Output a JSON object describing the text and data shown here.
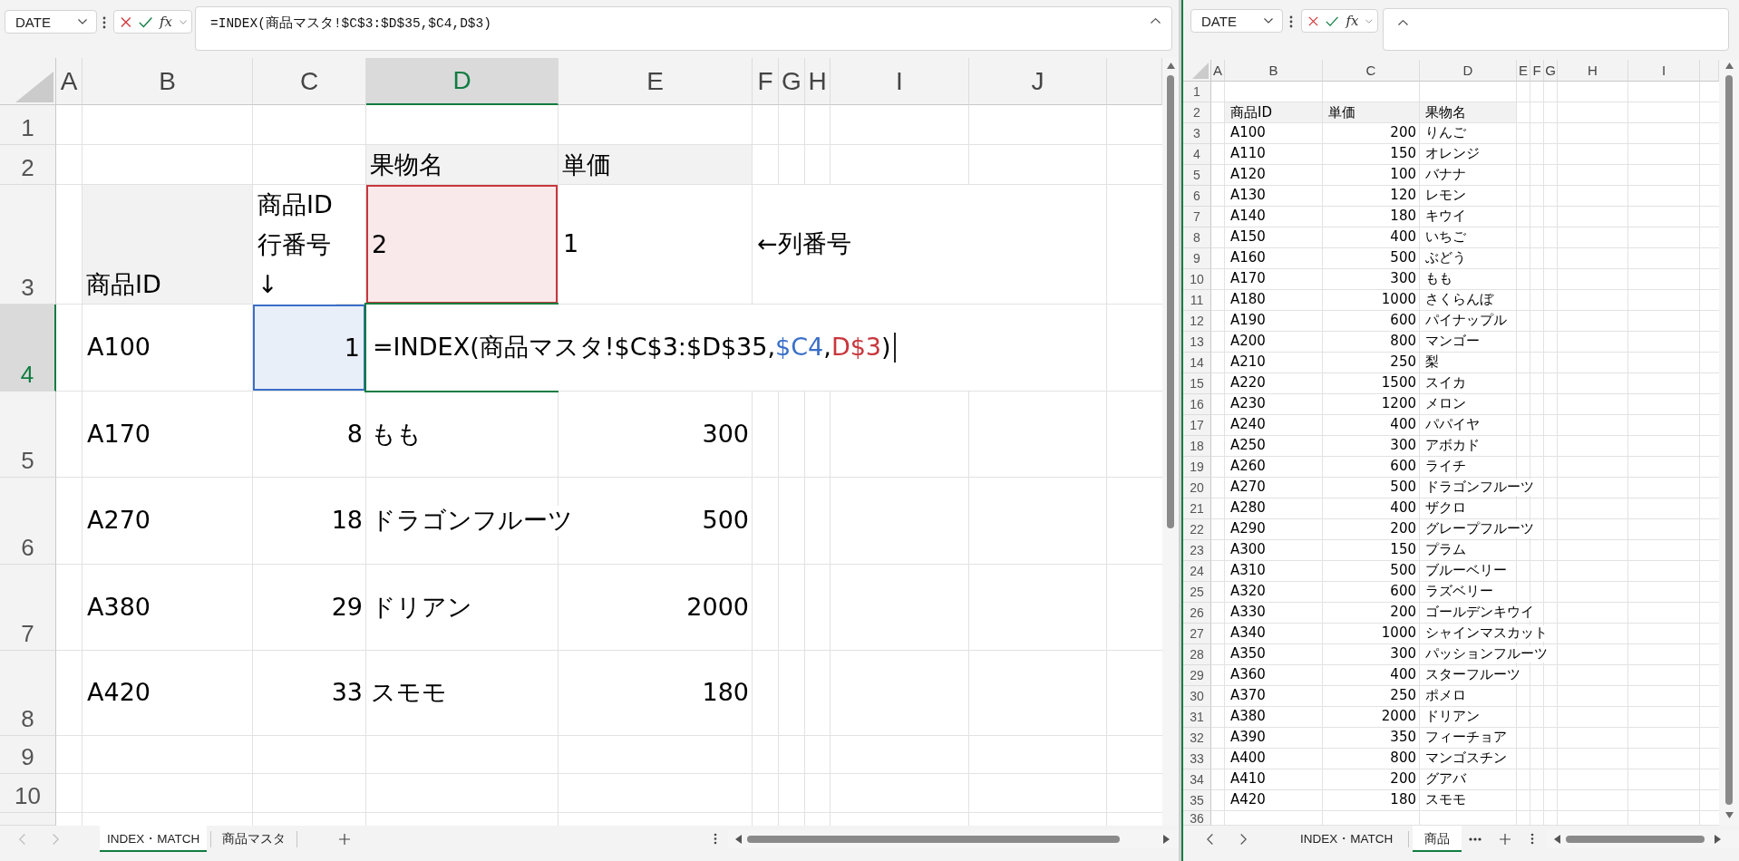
{
  "left_window": {
    "name_box": "DATE",
    "insert_function": "fx",
    "formula_bar": "=INDEX(商品マスタ!$C$3:$D$35,$C4,D$3)",
    "columns": [
      {
        "label": "A",
        "selected": false
      },
      {
        "label": "B",
        "selected": false
      },
      {
        "label": "C",
        "selected": false
      },
      {
        "label": "D",
        "selected": true
      },
      {
        "label": "E",
        "selected": false
      },
      {
        "label": "F",
        "selected": false
      },
      {
        "label": "G",
        "selected": false
      },
      {
        "label": "H",
        "selected": false
      },
      {
        "label": "I",
        "selected": false
      },
      {
        "label": "J",
        "selected": false
      }
    ],
    "rows": [
      {
        "label": "1",
        "selected": false
      },
      {
        "label": "2",
        "selected": false,
        "cells": [
          {
            "kind": "blank"
          },
          {
            "kind": "blank"
          },
          {
            "kind": "header",
            "text": "果物名"
          },
          {
            "kind": "header",
            "text": "単価"
          }
        ]
      },
      {
        "label": "3",
        "selected": false,
        "cells": [
          {
            "kind": "header",
            "text": "商品ID"
          },
          {
            "kind": "lines",
            "lines": [
              "商品ID",
              "行番号",
              "↓"
            ]
          },
          {
            "kind": "text",
            "text": "2",
            "color": "#c8363d"
          },
          {
            "kind": "text",
            "text": "1"
          },
          {
            "kind": "text",
            "text": "←列番号"
          }
        ]
      },
      {
        "label": "4",
        "selected": true,
        "cells": [
          {
            "kind": "text",
            "text": "A100"
          },
          {
            "kind": "number",
            "text": "1",
            "color": "#3a6fc8"
          },
          {
            "kind": "formula",
            "start": "=INDEX(商品マスタ!$C$3:$D$35,",
            "row_reference": {
              "text": "$C4",
              "color": "#3a6fc8"
            },
            "separator": ",",
            "column_reference": {
              "text": "D$3",
              "color": "#c8363d"
            },
            "end": ")"
          }
        ]
      },
      {
        "label": "5",
        "selected": false,
        "cells": [
          {
            "kind": "text",
            "text": "A170"
          },
          {
            "kind": "number",
            "text": "8"
          },
          {
            "kind": "text",
            "text": "もも"
          },
          {
            "kind": "number",
            "text": "300"
          }
        ]
      },
      {
        "label": "6",
        "selected": false,
        "cells": [
          {
            "kind": "text",
            "text": "A270"
          },
          {
            "kind": "number",
            "text": "18"
          },
          {
            "kind": "text",
            "text": "ドラゴンフルーツ"
          },
          {
            "kind": "number",
            "text": "500"
          }
        ]
      },
      {
        "label": "7",
        "selected": false,
        "cells": [
          {
            "kind": "text",
            "text": "A380"
          },
          {
            "kind": "number",
            "text": "29"
          },
          {
            "kind": "text",
            "text": "ドリアン"
          },
          {
            "kind": "number",
            "text": "2000"
          }
        ]
      },
      {
        "label": "8",
        "selected": false,
        "cells": [
          {
            "kind": "text",
            "text": "A420"
          },
          {
            "kind": "number",
            "text": "33"
          },
          {
            "kind": "text",
            "text": "スモモ"
          },
          {
            "kind": "number",
            "text": "180"
          }
        ]
      },
      {
        "label": "9",
        "selected": false
      },
      {
        "label": "10",
        "selected": false
      }
    ],
    "sheet_nav": {
      "disabled": true
    },
    "sheet_tabs": [
      {
        "label": "INDEX・MATCH",
        "selected": true
      },
      {
        "label": "商品マスタ",
        "selected": false
      }
    ]
  },
  "right_window": {
    "name_box": "DATE",
    "insert_function": "fx",
    "columns": [
      {
        "label": "A",
        "selected": false
      },
      {
        "label": "B",
        "selected": false
      },
      {
        "label": "C",
        "selected": false
      },
      {
        "label": "D",
        "selected": false
      },
      {
        "label": "E",
        "selected": false
      },
      {
        "label": "F",
        "selected": false
      },
      {
        "label": "G",
        "selected": false
      },
      {
        "label": "H",
        "selected": false
      },
      {
        "label": "I",
        "selected": false
      }
    ],
    "rows": [
      {
        "label": "1",
        "selected": false
      },
      {
        "label": "2",
        "selected": false,
        "cells": [
          {
            "kind": "header",
            "text": "商品ID"
          },
          {
            "kind": "header",
            "text": "単価"
          },
          {
            "kind": "header",
            "text": "果物名"
          }
        ]
      },
      {
        "label": "3",
        "selected": false,
        "cells": [
          {
            "kind": "text",
            "text": "A100"
          },
          {
            "kind": "number",
            "text": "200"
          },
          {
            "kind": "text",
            "text": "りんご"
          }
        ]
      },
      {
        "label": "4",
        "selected": false,
        "cells": [
          {
            "kind": "text",
            "text": "A110"
          },
          {
            "kind": "number",
            "text": "150"
          },
          {
            "kind": "text",
            "text": "オレンジ"
          }
        ]
      },
      {
        "label": "5",
        "selected": false,
        "cells": [
          {
            "kind": "text",
            "text": "A120"
          },
          {
            "kind": "number",
            "text": "100"
          },
          {
            "kind": "text",
            "text": "バナナ"
          }
        ]
      },
      {
        "label": "6",
        "selected": false,
        "cells": [
          {
            "kind": "text",
            "text": "A130"
          },
          {
            "kind": "number",
            "text": "120"
          },
          {
            "kind": "text",
            "text": "レモン"
          }
        ]
      },
      {
        "label": "7",
        "selected": false,
        "cells": [
          {
            "kind": "text",
            "text": "A140"
          },
          {
            "kind": "number",
            "text": "180"
          },
          {
            "kind": "text",
            "text": "キウイ"
          }
        ]
      },
      {
        "label": "8",
        "selected": false,
        "cells": [
          {
            "kind": "text",
            "text": "A150"
          },
          {
            "kind": "number",
            "text": "400"
          },
          {
            "kind": "text",
            "text": "いちご"
          }
        ]
      },
      {
        "label": "9",
        "selected": false,
        "cells": [
          {
            "kind": "text",
            "text": "A160"
          },
          {
            "kind": "number",
            "text": "500"
          },
          {
            "kind": "text",
            "text": "ぶどう"
          }
        ]
      },
      {
        "label": "10",
        "selected": false,
        "cells": [
          {
            "kind": "text",
            "text": "A170"
          },
          {
            "kind": "number",
            "text": "300"
          },
          {
            "kind": "text",
            "text": "もも"
          }
        ]
      },
      {
        "label": "11",
        "selected": false,
        "cells": [
          {
            "kind": "text",
            "text": "A180"
          },
          {
            "kind": "number",
            "text": "1000"
          },
          {
            "kind": "text",
            "text": "さくらんぼ"
          }
        ]
      },
      {
        "label": "12",
        "selected": false,
        "cells": [
          {
            "kind": "text",
            "text": "A190"
          },
          {
            "kind": "number",
            "text": "600"
          },
          {
            "kind": "text",
            "text": "パイナップル"
          }
        ]
      },
      {
        "label": "13",
        "selected": false,
        "cells": [
          {
            "kind": "text",
            "text": "A200"
          },
          {
            "kind": "number",
            "text": "800"
          },
          {
            "kind": "text",
            "text": "マンゴー"
          }
        ]
      },
      {
        "label": "14",
        "selected": false,
        "cells": [
          {
            "kind": "text",
            "text": "A210"
          },
          {
            "kind": "number",
            "text": "250"
          },
          {
            "kind": "text",
            "text": "梨"
          }
        ]
      },
      {
        "label": "15",
        "selected": false,
        "cells": [
          {
            "kind": "text",
            "text": "A220"
          },
          {
            "kind": "number",
            "text": "1500"
          },
          {
            "kind": "text",
            "text": "スイカ"
          }
        ]
      },
      {
        "label": "16",
        "selected": false,
        "cells": [
          {
            "kind": "text",
            "text": "A230"
          },
          {
            "kind": "number",
            "text": "1200"
          },
          {
            "kind": "text",
            "text": "メロン"
          }
        ]
      },
      {
        "label": "17",
        "selected": false,
        "cells": [
          {
            "kind": "text",
            "text": "A240"
          },
          {
            "kind": "number",
            "text": "400"
          },
          {
            "kind": "text",
            "text": "パパイヤ"
          }
        ]
      },
      {
        "label": "18",
        "selected": false,
        "cells": [
          {
            "kind": "text",
            "text": "A250"
          },
          {
            "kind": "number",
            "text": "300"
          },
          {
            "kind": "text",
            "text": "アボカド"
          }
        ]
      },
      {
        "label": "19",
        "selected": false,
        "cells": [
          {
            "kind": "text",
            "text": "A260"
          },
          {
            "kind": "number",
            "text": "600"
          },
          {
            "kind": "text",
            "text": "ライチ"
          }
        ]
      },
      {
        "label": "20",
        "selected": false,
        "cells": [
          {
            "kind": "text",
            "text": "A270"
          },
          {
            "kind": "number",
            "text": "500"
          },
          {
            "kind": "text",
            "text": "ドラゴンフルーツ"
          }
        ]
      },
      {
        "label": "21",
        "selected": false,
        "cells": [
          {
            "kind": "text",
            "text": "A280"
          },
          {
            "kind": "number",
            "text": "400"
          },
          {
            "kind": "text",
            "text": "ザクロ"
          }
        ]
      },
      {
        "label": "22",
        "selected": false,
        "cells": [
          {
            "kind": "text",
            "text": "A290"
          },
          {
            "kind": "number",
            "text": "200"
          },
          {
            "kind": "text",
            "text": "グレープフルーツ"
          }
        ]
      },
      {
        "label": "23",
        "selected": false,
        "cells": [
          {
            "kind": "text",
            "text": "A300"
          },
          {
            "kind": "number",
            "text": "150"
          },
          {
            "kind": "text",
            "text": "プラム"
          }
        ]
      },
      {
        "label": "24",
        "selected": false,
        "cells": [
          {
            "kind": "text",
            "text": "A310"
          },
          {
            "kind": "number",
            "text": "500"
          },
          {
            "kind": "text",
            "text": "ブルーベリー"
          }
        ]
      },
      {
        "label": "25",
        "selected": false,
        "cells": [
          {
            "kind": "text",
            "text": "A320"
          },
          {
            "kind": "number",
            "text": "600"
          },
          {
            "kind": "text",
            "text": "ラズベリー"
          }
        ]
      },
      {
        "label": "26",
        "selected": false,
        "cells": [
          {
            "kind": "text",
            "text": "A330"
          },
          {
            "kind": "number",
            "text": "200"
          },
          {
            "kind": "text",
            "text": "ゴールデンキウイ"
          }
        ]
      },
      {
        "label": "27",
        "selected": false,
        "cells": [
          {
            "kind": "text",
            "text": "A340"
          },
          {
            "kind": "number",
            "text": "1000"
          },
          {
            "kind": "text",
            "text": "シャインマスカット"
          }
        ]
      },
      {
        "label": "28",
        "selected": false,
        "cells": [
          {
            "kind": "text",
            "text": "A350"
          },
          {
            "kind": "number",
            "text": "300"
          },
          {
            "kind": "text",
            "text": "パッションフルーツ"
          }
        ]
      },
      {
        "label": "29",
        "selected": false,
        "cells": [
          {
            "kind": "text",
            "text": "A360"
          },
          {
            "kind": "number",
            "text": "400"
          },
          {
            "kind": "text",
            "text": "スターフルーツ"
          }
        ]
      },
      {
        "label": "30",
        "selected": false,
        "cells": [
          {
            "kind": "text",
            "text": "A370"
          },
          {
            "kind": "number",
            "text": "250"
          },
          {
            "kind": "text",
            "text": "ポメロ"
          }
        ]
      },
      {
        "label": "31",
        "selected": false,
        "cells": [
          {
            "kind": "text",
            "text": "A380"
          },
          {
            "kind": "number",
            "text": "2000"
          },
          {
            "kind": "text",
            "text": "ドリアン"
          }
        ]
      },
      {
        "label": "32",
        "selected": false,
        "cells": [
          {
            "kind": "text",
            "text": "A390"
          },
          {
            "kind": "number",
            "text": "350"
          },
          {
            "kind": "text",
            "text": "フィーチョア"
          }
        ]
      },
      {
        "label": "33",
        "selected": false,
        "cells": [
          {
            "kind": "text",
            "text": "A400"
          },
          {
            "kind": "number",
            "text": "800"
          },
          {
            "kind": "text",
            "text": "マンゴスチン"
          }
        ]
      },
      {
        "label": "34",
        "selected": false,
        "cells": [
          {
            "kind": "text",
            "text": "A410"
          },
          {
            "kind": "number",
            "text": "200"
          },
          {
            "kind": "text",
            "text": "グアバ"
          }
        ]
      },
      {
        "label": "35",
        "selected": false,
        "cells": [
          {
            "kind": "text",
            "text": "A420"
          },
          {
            "kind": "number",
            "text": "180"
          },
          {
            "kind": "text",
            "text": "スモモ"
          }
        ]
      },
      {
        "label": "36",
        "selected": false
      }
    ],
    "sheet_nav": {
      "disabled": false
    },
    "sheet_tabs": [
      {
        "label": "INDEX・MATCH",
        "selected": false
      },
      {
        "label": "商品",
        "selected": true
      }
    ]
  }
}
